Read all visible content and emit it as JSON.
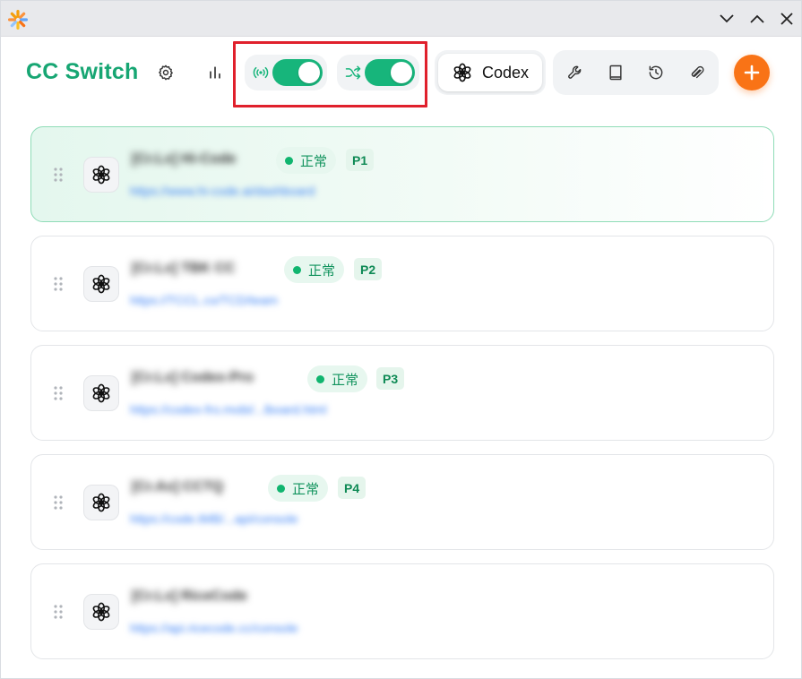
{
  "header": {
    "app_title": "CC Switch",
    "current_app": "Codex"
  },
  "toggles": {
    "proxy_enabled": true,
    "failover_enabled": true
  },
  "colors": {
    "brand": "#17a673",
    "toggle_on": "#17b57b",
    "add_button": "#f97316",
    "highlight_box": "#e0202c",
    "link": "#3b82f6"
  },
  "providers": [
    {
      "name": "[Cr.Lx] Hi-Code",
      "url": "https://www.hi-code.ai/dashboard",
      "status": "正常",
      "priority": "P1",
      "active": true
    },
    {
      "name": "[Cr.Lx] TBK CC",
      "url": "https://TCCL.co/TCD/team",
      "status": "正常",
      "priority": "P2",
      "active": false
    },
    {
      "name": "[Cr.Lx] Codex-Pro",
      "url": "https://codex-fro.mobi/...lboard.html",
      "status": "正常",
      "priority": "P3",
      "active": false
    },
    {
      "name": "[Cr.Ax] CCTQ",
      "url": "https://code.tMB/...api/console",
      "status": "正常",
      "priority": "P4",
      "active": false
    },
    {
      "name": "[Cr.Lx] RiceCode",
      "url": "https://api.ricecode.cc/console",
      "status": "",
      "priority": "",
      "active": false
    }
  ]
}
